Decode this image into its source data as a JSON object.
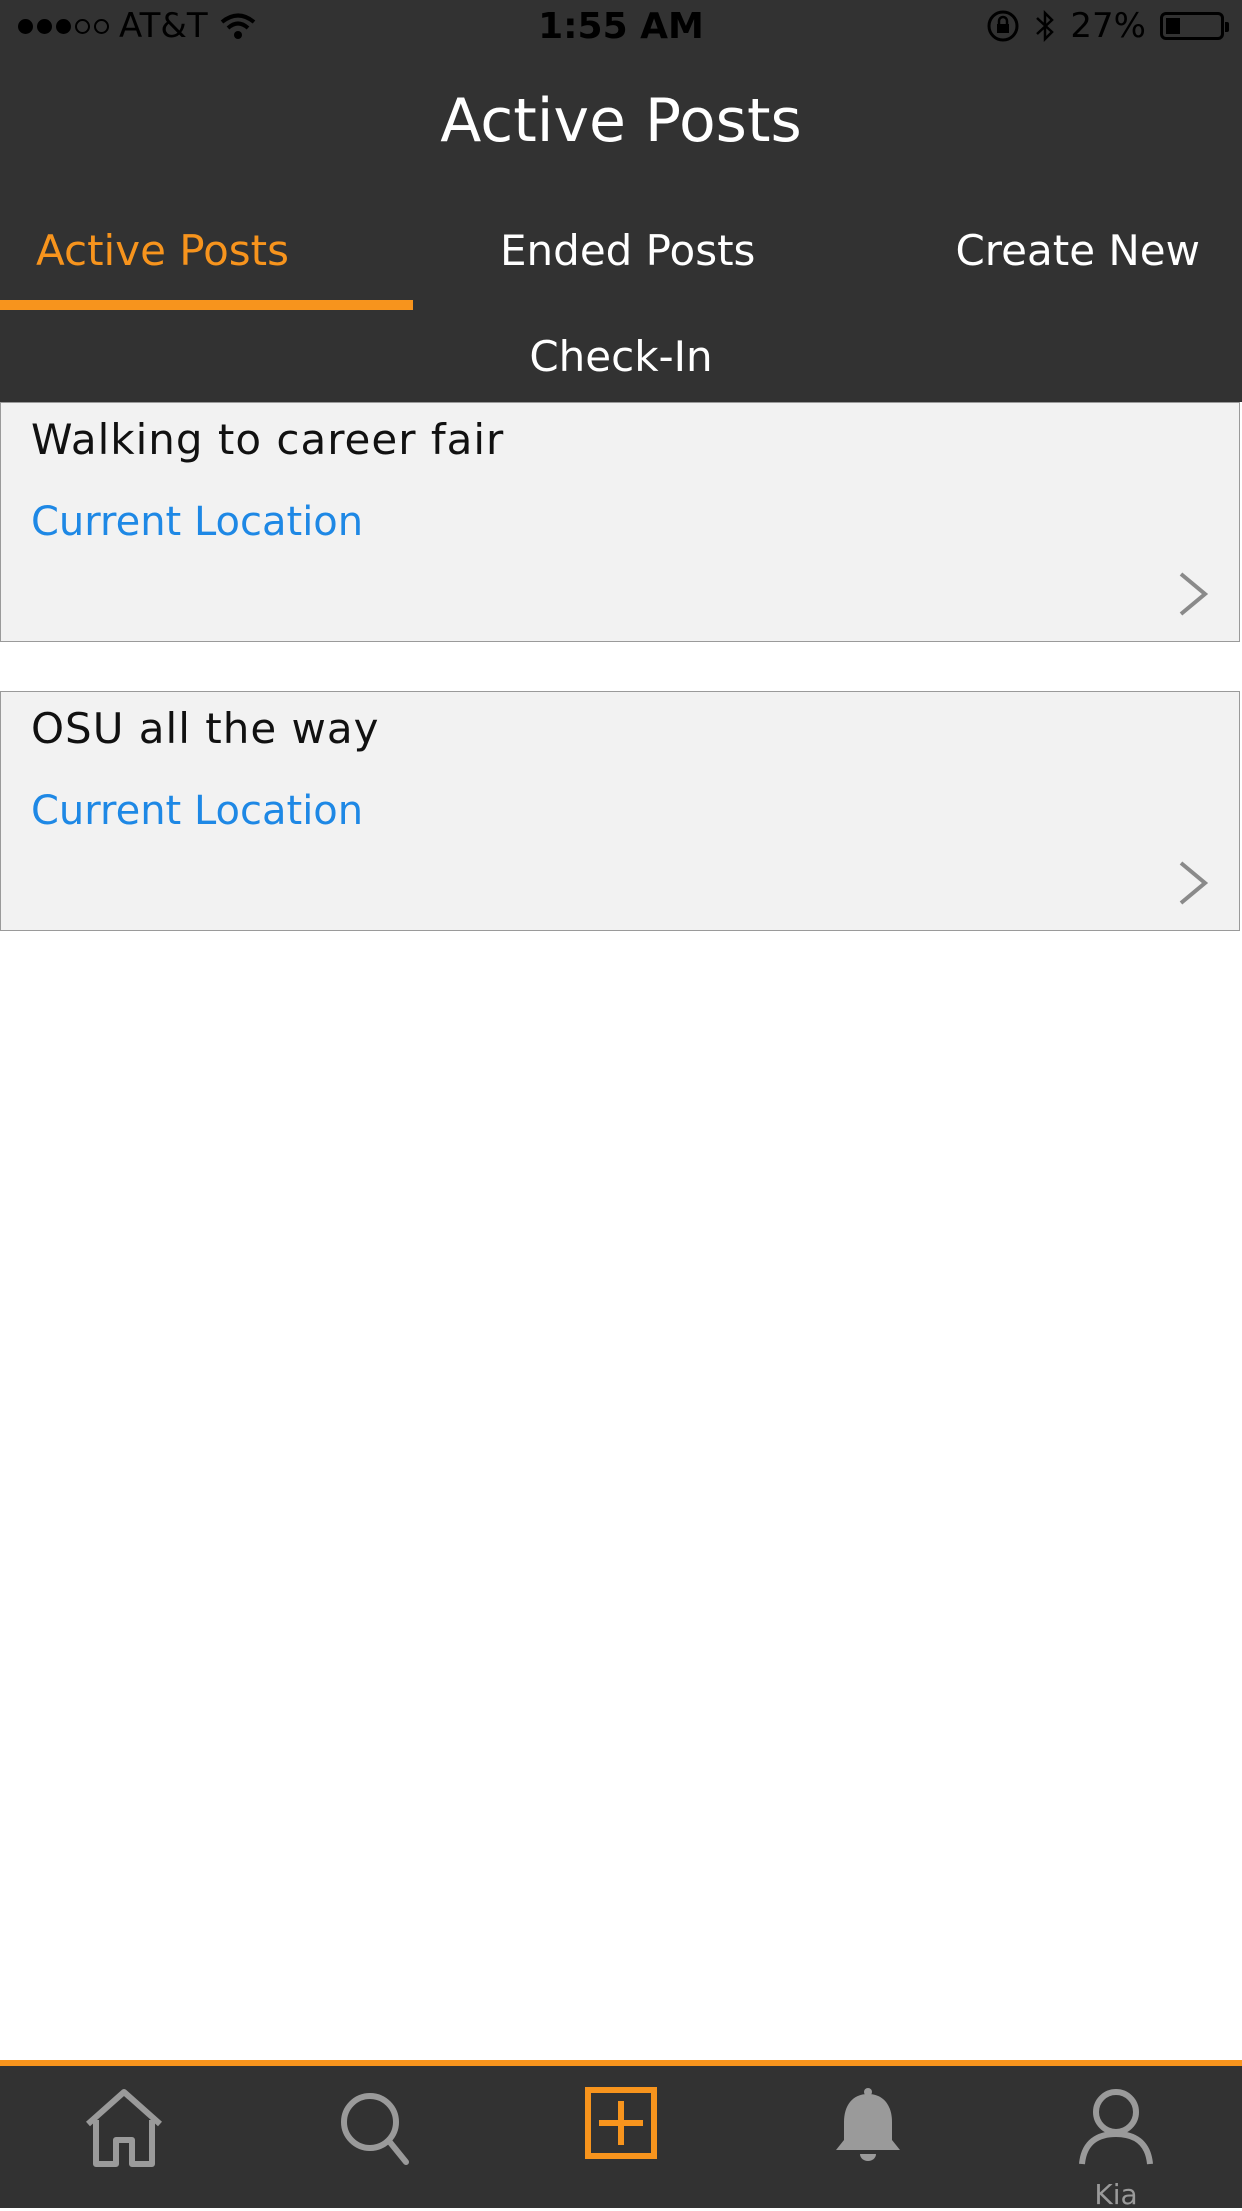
{
  "status_bar": {
    "carrier": "AT&T",
    "time": "1:55 AM",
    "battery_percent": "27%",
    "battery_level": 0.27,
    "signal_bars_filled": 3,
    "signal_bars_total": 5
  },
  "header": {
    "title": "Active Posts"
  },
  "tabs": [
    {
      "label": "Active Posts",
      "selected": true
    },
    {
      "label": "Ended Posts",
      "selected": false
    },
    {
      "label": "Create New",
      "selected": false
    },
    {
      "label": "Check-In",
      "selected": false
    }
  ],
  "posts": [
    {
      "title": "Walking to career fair",
      "location": "Current Location"
    },
    {
      "title": "OSU all the way",
      "location": "Current Location"
    }
  ],
  "tab_bar": {
    "items": [
      {
        "icon": "home-icon"
      },
      {
        "icon": "search-icon"
      },
      {
        "icon": "add-post-icon"
      },
      {
        "icon": "bell-icon"
      },
      {
        "icon": "profile-icon",
        "label": "Kia"
      }
    ]
  },
  "colors": {
    "accent": "#f7941d",
    "header_bg": "#323232",
    "link": "#1e88e5",
    "card_bg": "#f2f2f2"
  }
}
